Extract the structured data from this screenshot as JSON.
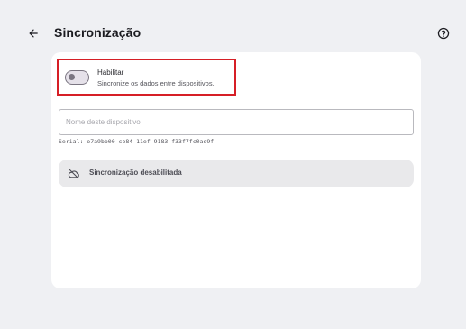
{
  "header": {
    "title": "Sincronização",
    "back_icon": "arrow-left-icon",
    "help_icon": "help-circle-icon"
  },
  "sync_toggle": {
    "label": "Habilitar",
    "description": "Sincronize os dados entre dispositivos.",
    "enabled": false
  },
  "device_name": {
    "placeholder": "Nome deste dispositivo",
    "value": ""
  },
  "serial": {
    "text": "Serial: e7a9bb00-ce84-11ef-9183-f33f7fc0ad9f"
  },
  "status": {
    "icon": "cloud-off-icon",
    "text": "Sincronização desabilitada"
  },
  "colors": {
    "background": "#eff0f3",
    "card": "#ffffff",
    "highlight_border": "#d61f26",
    "status_bg": "#e9e9eb"
  }
}
